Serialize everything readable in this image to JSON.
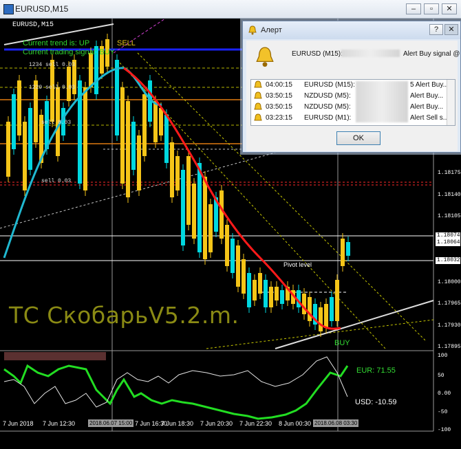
{
  "window": {
    "title": "EURUSD,M15"
  },
  "chart": {
    "symbol_label": "EURUSD,M15",
    "trend_text": "Current trend is: UP",
    "signal_text": "Current trading signal: BUY",
    "sell_label": "SELL",
    "buy_label": "BUY",
    "orders": [
      "1234 sell 0.03",
      "1229 sell 0.03",
      "sell 0.03",
      "sell 0.03"
    ],
    "pivot_label": "Pivot level",
    "system_title": "ТС СкобарьV5.2.m.",
    "price_axis": [
      "1.18175",
      "1.18140",
      "1.18105",
      "1.18000",
      "1.17965",
      "1.17930",
      "1.17895"
    ],
    "price_boxes": [
      "1.18074",
      "1.18064",
      "1.18032"
    ],
    "indicator_axis": [
      "100",
      "50",
      "0.00",
      "-50",
      "-100"
    ],
    "eur_label": "EUR: 71.55",
    "usd_label": "USD: -10.59",
    "time_axis": [
      "7 Jun 2018",
      "7 Jun 12:30",
      "7 Jun 16:30",
      "7 Jun 18:30",
      "7 Jun 20:30",
      "7 Jun 22:30",
      "8 Jun 00:30"
    ],
    "time_boxes": [
      "2018.06.07 15:00",
      "2018.06.08 03:30"
    ],
    "colors": {
      "bull": "#f5c518",
      "bear": "#00d8e0",
      "ma": "#ff1a1a",
      "eur_line": "#22dd22",
      "usd_line": "#ffffff"
    }
  },
  "alert": {
    "title": "Алерт",
    "help_button": "?",
    "close_button": "✕",
    "main_symbol": "EURUSD (M15):",
    "main_text": "Alert Buy signal @",
    "rows": [
      {
        "time": "04:00:15",
        "symbol": "EURUSD (M15):",
        "text": "5 Alert Buy..."
      },
      {
        "time": "03:50:15",
        "symbol": "NZDUSD (M5):",
        "text": "Alert Buy..."
      },
      {
        "time": "03:50:15",
        "symbol": "NZDUSD (M5):",
        "text": "Alert Buy..."
      },
      {
        "time": "03:23:15",
        "symbol": "EURUSD (M1):",
        "text": "Alert Sell s..."
      }
    ],
    "ok_label": "OK"
  }
}
